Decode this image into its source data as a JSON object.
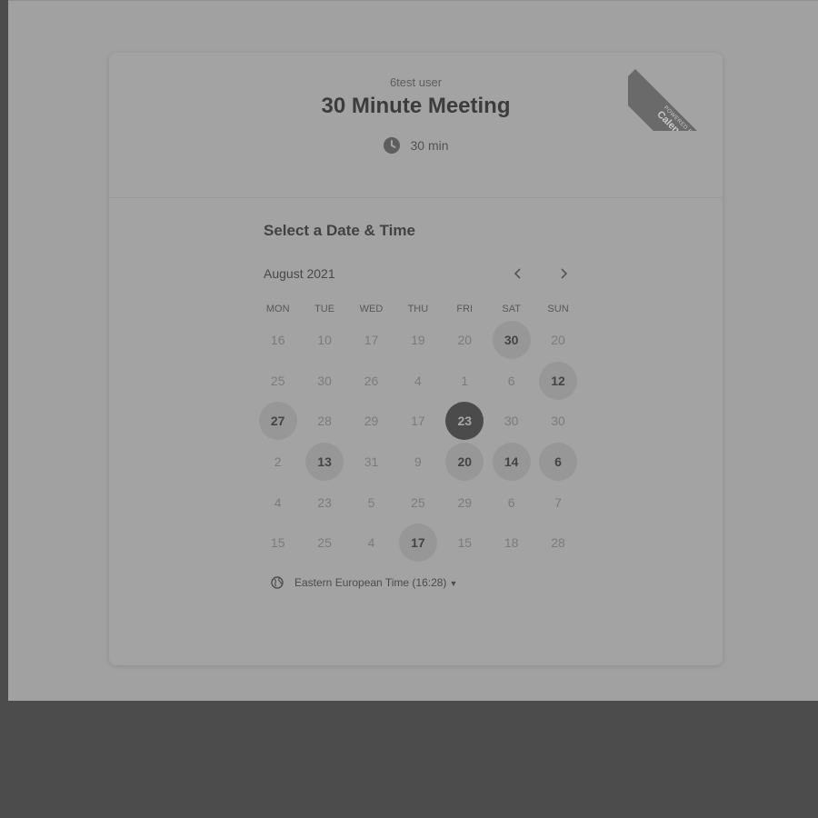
{
  "event": {
    "host": "6test user",
    "title": "30 Minute Meeting",
    "duration": "30 min"
  },
  "ribbon": {
    "line1": "POWERED BY",
    "line2": "Calendly"
  },
  "calendar": {
    "heading": "Select a Date & Time",
    "month": "August 2021",
    "weekdays": [
      "MON",
      "TUE",
      "WED",
      "THU",
      "FRI",
      "SAT",
      "SUN"
    ],
    "days": [
      {
        "label": "16",
        "state": "unavailable"
      },
      {
        "label": "10",
        "state": "unavailable"
      },
      {
        "label": "17",
        "state": "unavailable"
      },
      {
        "label": "19",
        "state": "unavailable"
      },
      {
        "label": "20",
        "state": "unavailable"
      },
      {
        "label": "30",
        "state": "available"
      },
      {
        "label": "20",
        "state": "unavailable"
      },
      {
        "label": "25",
        "state": "unavailable"
      },
      {
        "label": "30",
        "state": "unavailable"
      },
      {
        "label": "26",
        "state": "unavailable"
      },
      {
        "label": "4",
        "state": "unavailable"
      },
      {
        "label": "1",
        "state": "unavailable"
      },
      {
        "label": "6",
        "state": "unavailable"
      },
      {
        "label": "12",
        "state": "available"
      },
      {
        "label": "27",
        "state": "available"
      },
      {
        "label": "28",
        "state": "unavailable"
      },
      {
        "label": "29",
        "state": "unavailable"
      },
      {
        "label": "17",
        "state": "unavailable"
      },
      {
        "label": "23",
        "state": "selected"
      },
      {
        "label": "30",
        "state": "unavailable"
      },
      {
        "label": "30",
        "state": "unavailable"
      },
      {
        "label": "2",
        "state": "unavailable"
      },
      {
        "label": "13",
        "state": "available"
      },
      {
        "label": "31",
        "state": "unavailable"
      },
      {
        "label": "9",
        "state": "unavailable"
      },
      {
        "label": "20",
        "state": "available"
      },
      {
        "label": "14",
        "state": "available"
      },
      {
        "label": "6",
        "state": "available"
      },
      {
        "label": "4",
        "state": "unavailable"
      },
      {
        "label": "23",
        "state": "unavailable"
      },
      {
        "label": "5",
        "state": "unavailable"
      },
      {
        "label": "25",
        "state": "unavailable"
      },
      {
        "label": "29",
        "state": "unavailable"
      },
      {
        "label": "6",
        "state": "unavailable"
      },
      {
        "label": "7",
        "state": "unavailable"
      },
      {
        "label": "15",
        "state": "unavailable"
      },
      {
        "label": "25",
        "state": "unavailable"
      },
      {
        "label": "4",
        "state": "unavailable"
      },
      {
        "label": "17",
        "state": "available"
      },
      {
        "label": "15",
        "state": "unavailable"
      },
      {
        "label": "18",
        "state": "unavailable"
      },
      {
        "label": "28",
        "state": "unavailable"
      }
    ]
  },
  "timezone": {
    "label": "Eastern European Time (16:28)"
  },
  "icons": {
    "clock": "clock-icon",
    "globe": "globe-icon",
    "prev": "chevron-left-icon",
    "next": "chevron-right-icon",
    "caret": "caret-down-icon"
  }
}
